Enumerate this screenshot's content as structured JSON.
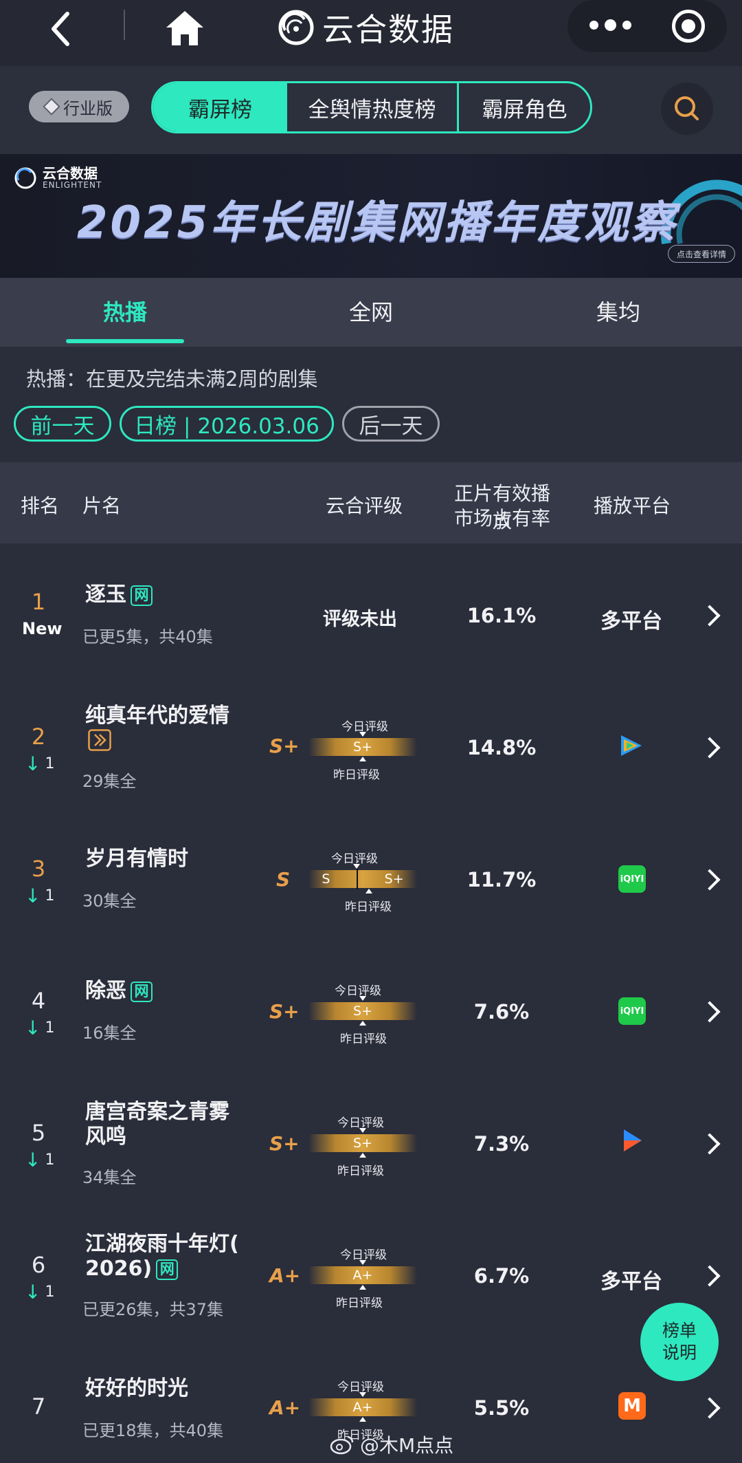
{
  "topbar": {
    "brand": "云合数据"
  },
  "switch": {
    "edition": "行业版",
    "segments": [
      "霸屏榜",
      "全舆情热度榜",
      "霸屏角色"
    ]
  },
  "banner": {
    "logo_cn": "云合数据",
    "logo_en": "ENLIGHTENT",
    "title": "2025年长剧集网播年度观察",
    "cta": "点击查看详情"
  },
  "tabs": [
    "热播",
    "全网",
    "集均"
  ],
  "description": "热播：在更及完结未满2周的剧集",
  "date_nav": {
    "prev": "前一天",
    "current": "日榜 | 2026.03.06",
    "next": "后一天"
  },
  "table": {
    "headers": {
      "rank": "排名",
      "name": "片名",
      "grade": "云合评级",
      "share_line1": "正片有效播放",
      "share_line2": "市场占有率",
      "platform": "播放平台"
    },
    "today_label": "今日评级",
    "yesterday_label": "昨日评级",
    "rows": [
      {
        "rank": "1",
        "change": "New",
        "title": "逐玉",
        "net": "网",
        "sub": "已更5集，共40集",
        "grade": "",
        "grade_status": "评级未出",
        "share": "16.1%",
        "platform": "多平台"
      },
      {
        "rank": "2",
        "change": "1",
        "title": "纯真年代的爱情",
        "sub": "29集全",
        "grade": "S+",
        "bar_today": "S+",
        "share": "14.8%",
        "platform_icon": "tencent-video-icon"
      },
      {
        "rank": "3",
        "change": "1",
        "title": "岁月有情时",
        "sub": "30集全",
        "grade": "S",
        "bar_left": "S",
        "bar_right": "S+",
        "share": "11.7%",
        "platform_icon": "iqiyi-icon"
      },
      {
        "rank": "4",
        "change": "1",
        "title": "除恶",
        "net": "网",
        "sub": "16集全",
        "grade": "S+",
        "bar_today": "S+",
        "share": "7.6%",
        "platform_icon": "iqiyi-icon"
      },
      {
        "rank": "5",
        "change": "1",
        "title_line1": "唐宫奇案之青雾",
        "title_line2": "风鸣",
        "sub": "34集全",
        "grade": "S+",
        "bar_today": "S+",
        "share": "7.3%",
        "platform_icon": "youku-icon"
      },
      {
        "rank": "6",
        "change": "1",
        "title_line1": "江湖夜雨十年灯(",
        "title_line2": "2026)",
        "net": "网",
        "sub": "已更26集，共37集",
        "grade": "A+",
        "bar_today": "A+",
        "share": "6.7%",
        "platform": "多平台"
      },
      {
        "rank": "7",
        "change": "",
        "title": "好好的时光",
        "sub": "已更18集，共40集",
        "grade": "A+",
        "bar_today": "A+",
        "share": "5.5%",
        "platform_icon": "mango-tv-icon"
      }
    ]
  },
  "fab": {
    "line1": "榜单",
    "line2": "说明"
  },
  "watermark": {
    "text": "@木M点点"
  },
  "colors": {
    "accent": "#2ee8bf",
    "gold": "#e8a04a",
    "bg": "#2a2d3a"
  }
}
